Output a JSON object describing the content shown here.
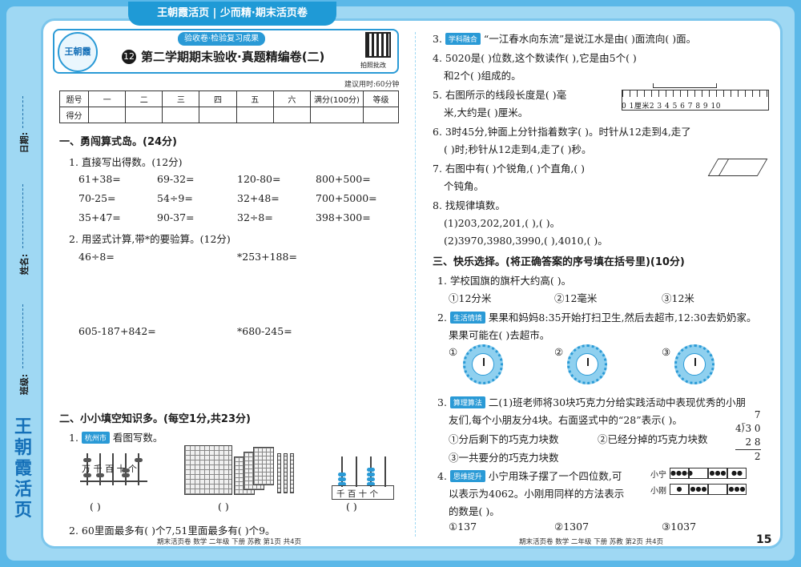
{
  "banner": "王朝霞活页 | 少而精·期末活页卷",
  "brand_vertical": [
    "王",
    "朝",
    "霞",
    "活",
    "页"
  ],
  "logo_text": "王朝霞",
  "side_fields": {
    "date": "日期:",
    "name": "姓名:",
    "class": "班级:"
  },
  "header": {
    "subtitle": "验收卷·检验复习成果",
    "number": "12",
    "title": "第二学期期末验收·真题精编卷(二)",
    "qr_label": "拍照批改",
    "time_note": "建议用时:60分钟"
  },
  "score_table": {
    "row1": [
      "题号",
      "一",
      "二",
      "三",
      "四",
      "五",
      "六",
      "满分(100分)",
      "等级"
    ],
    "row2": [
      "得分",
      "",
      "",
      "",
      "",
      "",
      "",
      "",
      ""
    ]
  },
  "left": {
    "sec1": "一、勇闯算式岛。(24分)",
    "q1": "1. 直接写出得数。(12分)",
    "calc": [
      [
        "61+38=",
        "69-32=",
        "120-80=",
        "800+500="
      ],
      [
        "70-25=",
        "54÷9=",
        "32+48=",
        "700+5000="
      ],
      [
        "35+47=",
        "90-37=",
        "32÷8=",
        "398+300="
      ]
    ],
    "q2": "2. 用竖式计算,带*的要验算。(12分)",
    "vert": [
      "46÷8=",
      "*253+188=",
      "605-187+842=",
      "*680-245="
    ],
    "sec2": "二、小小填空知识多。(每空1分,共23分)",
    "q2_1_tag": "杭州市",
    "q2_1": "看图写数。",
    "abacus_labels1": "万 千 百 十 个",
    "abacus_labels2": "千 百 十 个",
    "blank": "(     )",
    "q2_2": "2. 60里面最多有(        )个7,51里面最多有(        )个9。",
    "footer": "期末活页卷  数学  二年级  下册  苏教  第1页  共4页"
  },
  "right": {
    "q3_tag": "学科融合",
    "q3": "“一江春水向东流”是说江水是由(      )面流向(      )面。",
    "q4a": "4. 5020是(      )位数,这个数读作(              ),它是由5个(      )",
    "q4b": "和2个(      )组成的。",
    "q5a": "5. 右图所示的线段长度是(      )毫",
    "q5b": "米,大约是(      )厘米。",
    "ruler_nums": "0 1厘米2 3 4 5 6 7 8 9 10",
    "q6a": "6. 3时45分,钟面上分针指着数字(      )。时针从12走到4,走了",
    "q6b": "(      )时;秒针从12走到4,走了(      )秒。",
    "q7a": "7. 右图中有(      )个锐角,(      )个直角,(      )",
    "q7b": "个钝角。",
    "q8": "8. 找规律填数。",
    "q8_1": "(1)203,202,201,(        ),(        )。",
    "q8_2": "(2)3970,3980,3990,(        ),4010,(        )。",
    "sec3": "三、快乐选择。(将正确答案的序号填在括号里)(10分)",
    "c1": "1. 学校国旗的旗杆大约高(      )。",
    "c1_opts": [
      "①12分米",
      "②12毫米",
      "③12米"
    ],
    "c2_tag": "生活情境",
    "c2a": "果果和妈妈8:35开始打扫卫生,然后去超市,12:30去奶奶家。",
    "c2b": "果果可能在(      )去超市。",
    "clock_labels": [
      "①",
      "②",
      "③"
    ],
    "c3_tag": "算理算法",
    "c3a": "二(1)班老师将30块巧克力分给实践活动中表现优秀的小朋",
    "c3b": "友们,每个小朋友分4块。右面竖式中的“28”表示(      )。",
    "c3_opts": [
      "①分后剩下的巧克力块数",
      "②已经分掉的巧克力块数",
      "③一共要分的巧克力块数"
    ],
    "div_lines": [
      "7",
      "4⟌3 0",
      "2 8",
      "2"
    ],
    "c4_tag": "思维提升",
    "c4a": "小宁用珠子摆了一个四位数,可",
    "c4b": "以表示为4062。小刚用同样的方法表示",
    "c4c": "的数是(      )。",
    "c4_row_labels": [
      "小宁",
      "小刚"
    ],
    "c4_opts": [
      "①137",
      "②1307",
      "③1037"
    ],
    "footer": "期末活页卷  数学  二年级  下册  苏教  第2页  共4页",
    "page": "15"
  }
}
